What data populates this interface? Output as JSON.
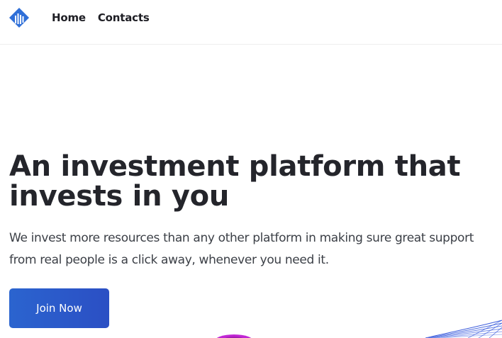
{
  "header": {
    "logo_icon": "diamond-bars-logo-icon",
    "nav": {
      "home_label": "Home",
      "contacts_label": "Contacts"
    }
  },
  "hero": {
    "title": "An investment platform that invests in you",
    "subtitle": "We invest more resources than any other platform in making sure great support from real people is a click away, whenever you need it.",
    "cta_label": "Join Now"
  },
  "colors": {
    "brand_blue": "#2b64cf",
    "logo_blue": "#2f6fd8",
    "decor_purple": "#c026d3",
    "decor_blue": "#3b5bdb"
  }
}
